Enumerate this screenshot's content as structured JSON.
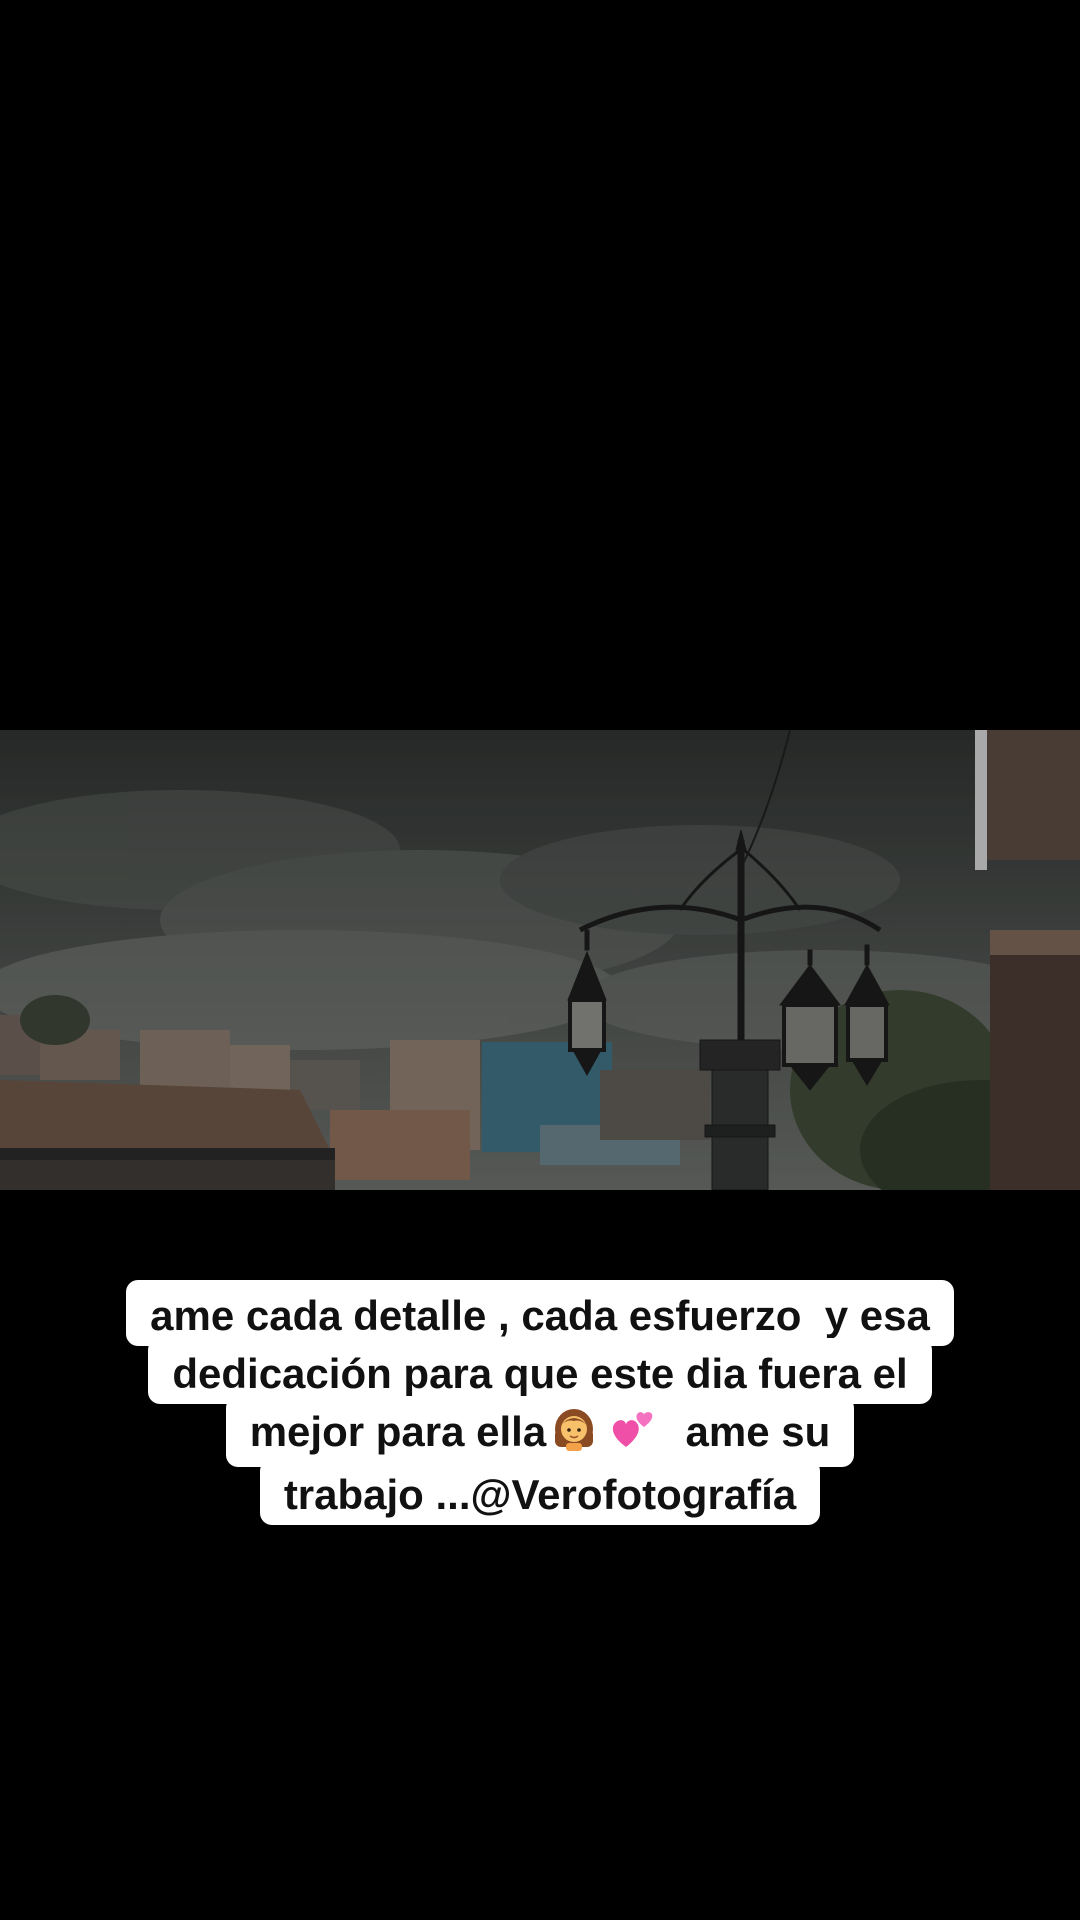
{
  "video": {
    "scene": "video-frame"
  },
  "caption": {
    "line1": "ame cada detalle , cada esfuerzo  y esa",
    "line2": "dedicación para que este dia fuera el",
    "line3_start": "mejor para ella",
    "line3_end": "  ame su",
    "line4": "trabajo ...@Verofotografía",
    "emojis": [
      "girl-emoji",
      "two-hearts-emoji"
    ]
  },
  "colors": {
    "background": "#000000",
    "caption_bg": "#ffffff",
    "caption_text": "#111111"
  }
}
